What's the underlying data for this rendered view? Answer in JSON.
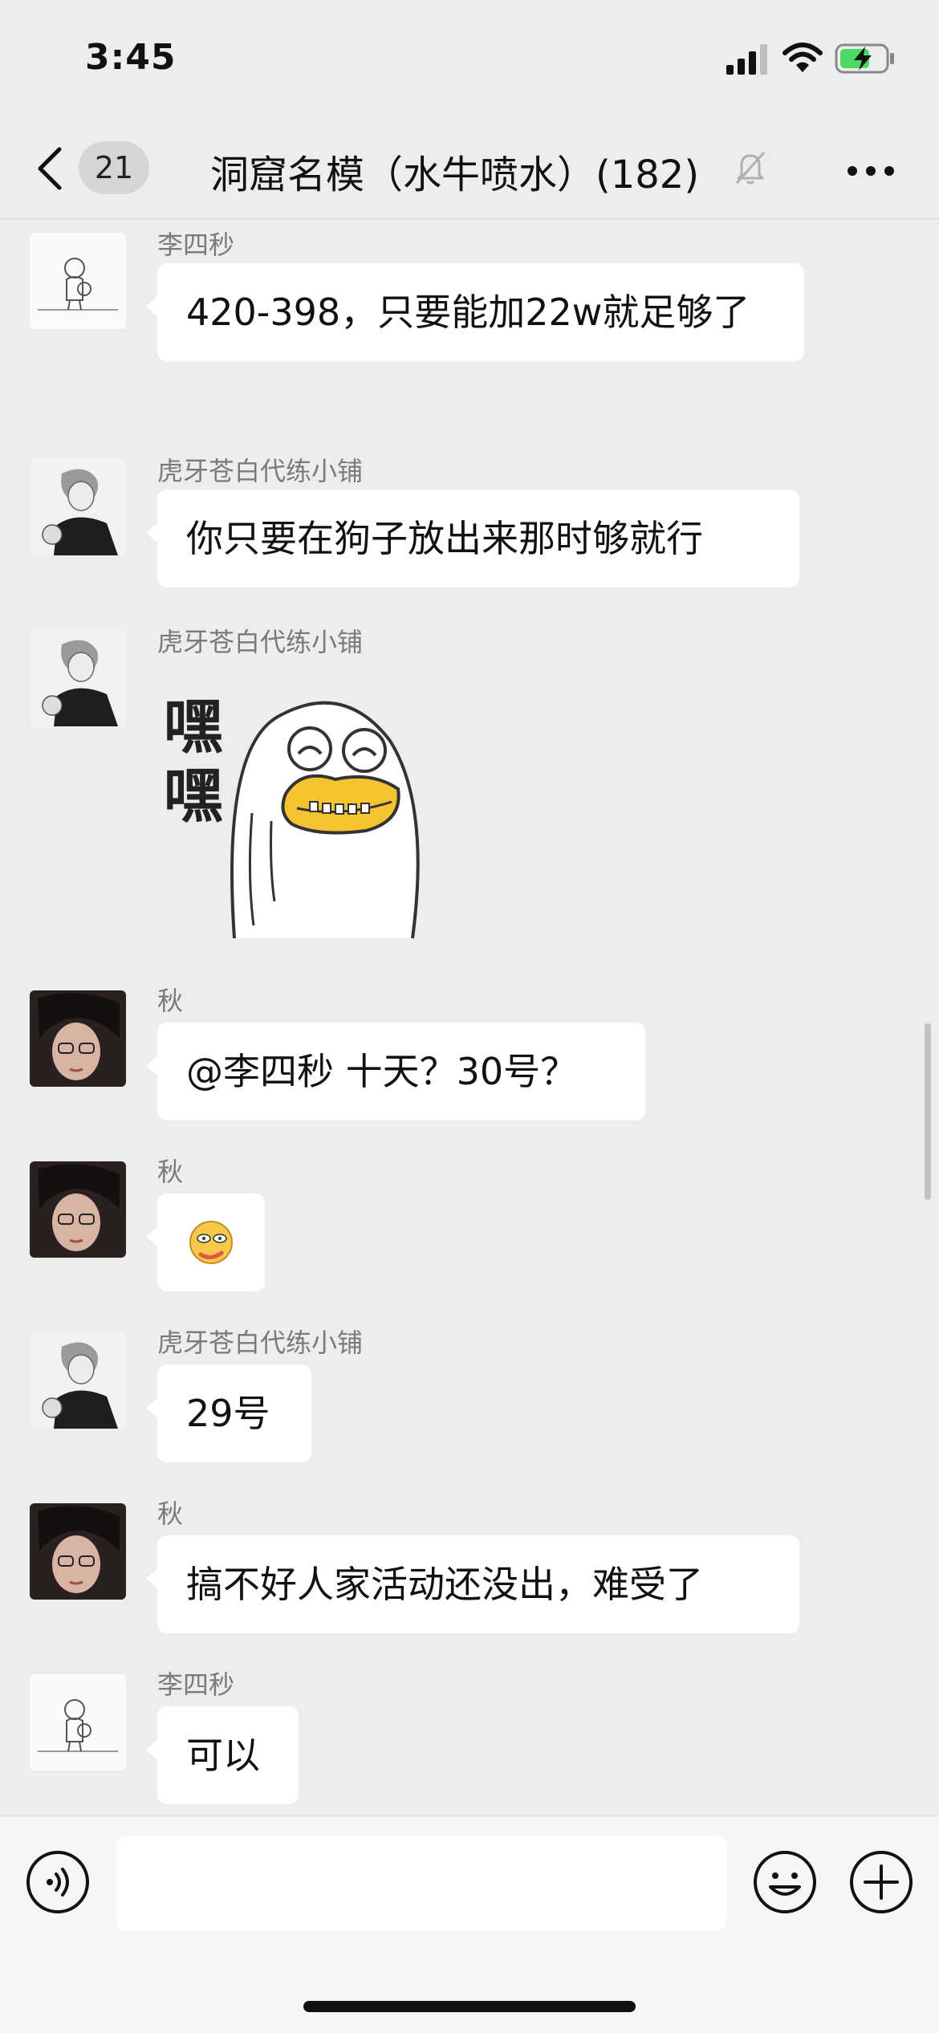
{
  "status_bar": {
    "time": "3:45"
  },
  "nav": {
    "back_count": "21",
    "title": "洞窟名模（水牛喷水）(182)"
  },
  "messages": [
    {
      "sender": "李四秒",
      "text": "420-398，只要能加22w就足够了"
    },
    {
      "sender": "虎牙苍白代练小铺",
      "text": "你只要在狗子放出来那时够就行"
    },
    {
      "sender": "虎牙苍白代练小铺",
      "sticker_text": "嘿嘿"
    },
    {
      "sender": "秋",
      "text": "@李四秒 十天？30号？"
    },
    {
      "sender": "秋",
      "emoji": "🥴"
    },
    {
      "sender": "虎牙苍白代练小铺",
      "text": "29号"
    },
    {
      "sender": "秋",
      "text": "搞不好人家活动还没出，难受了"
    },
    {
      "sender": "李四秒",
      "text": "可以"
    }
  ],
  "input_bar": {
    "message_value": "",
    "icons": [
      "voice-icon",
      "emoji-icon",
      "plus-icon"
    ]
  },
  "colors": {
    "background": "#ededed",
    "bubble": "#ffffff",
    "name": "#7a7a7a",
    "battery": "#4cd964"
  }
}
